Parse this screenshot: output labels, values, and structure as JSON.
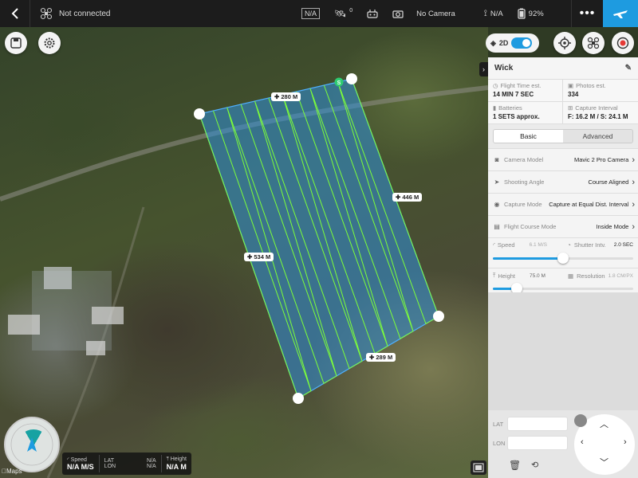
{
  "topbar": {
    "connection_status": "Not connected",
    "rc_label": "N/A",
    "gps_count": "0",
    "camera_status": "No Camera",
    "signal_label": "N/A",
    "battery": "92%"
  },
  "map": {
    "toggle_label": "2D",
    "distances": {
      "top": "280 M",
      "right": "446 M",
      "left": "534 M",
      "bottom": "289 M"
    },
    "start_marker": "S",
    "maps_attribution": "Maps"
  },
  "panel": {
    "title": "Wick",
    "stats": [
      {
        "label": "Flight Time est.",
        "value": "14 MIN 7 SEC",
        "icon": "clock-icon"
      },
      {
        "label": "Photos est.",
        "value": "334",
        "icon": "photos-icon"
      },
      {
        "label": "Batteries",
        "value": "1 SETS approx.",
        "icon": "battery-icon"
      },
      {
        "label": "Capture Interval",
        "value": "F: 16.2 M / S: 24.1 M",
        "icon": "interval-icon"
      }
    ],
    "tabs": {
      "basic": "Basic",
      "advanced": "Advanced"
    },
    "rows": [
      {
        "label": "Camera Model",
        "value": "Mavic 2 Pro Camera",
        "icon": "camera-icon"
      },
      {
        "label": "Shooting Angle",
        "value": "Course Aligned",
        "icon": "angle-icon"
      },
      {
        "label": "Capture Mode",
        "value": "Capture at Equal Dist. Interval",
        "icon": "capture-icon"
      },
      {
        "label": "Flight Course Mode",
        "value": "Inside Mode",
        "icon": "course-icon"
      }
    ],
    "speed": {
      "label": "Speed",
      "value": "6.1 M/S",
      "shutter_label": "Shutter Intv.",
      "shutter_value": "2.0 SEC",
      "level": 0.5
    },
    "height": {
      "label": "Height",
      "value": "75.0 M",
      "resolution_label": "Resolution",
      "resolution_value": "1.8 CM/PX",
      "level": 0.17
    },
    "lat_label": "LAT",
    "lon_label": "LON"
  },
  "telemetry": {
    "speed_label": "Speed",
    "speed_value": "N/A M/S",
    "lat_label": "LAT",
    "lat_value": "N/A",
    "lon_label": "LON",
    "lon_value": "N/A",
    "height_label": "Height",
    "height_value": "N/A M"
  },
  "colors": {
    "accent": "#1e9be0",
    "survey_fill": "#2f8fd8",
    "flight_lines": "#7dff3a"
  }
}
